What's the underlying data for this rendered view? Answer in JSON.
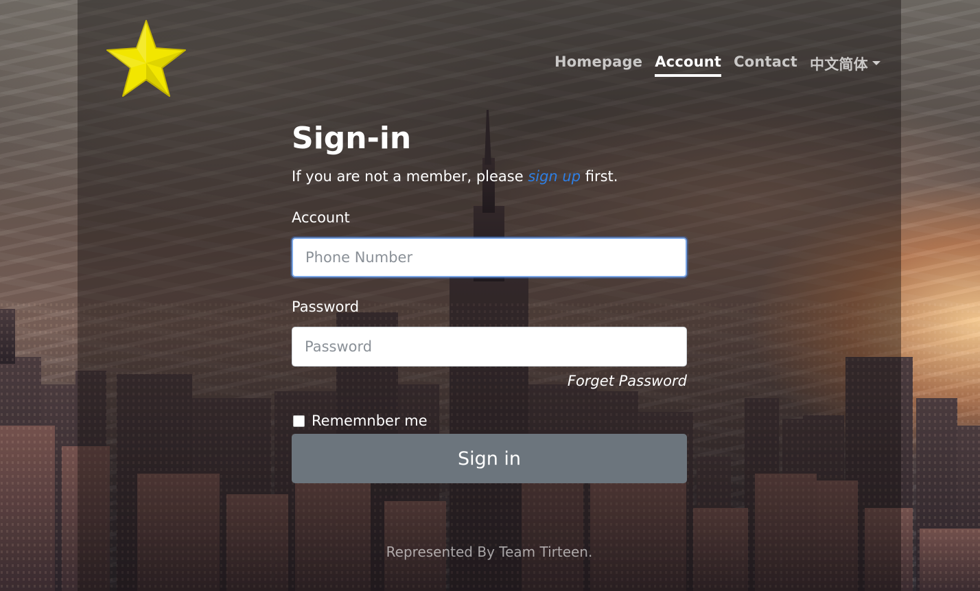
{
  "nav": {
    "items": [
      {
        "label": "Homepage",
        "active": false
      },
      {
        "label": "Account",
        "active": true
      },
      {
        "label": "Contact",
        "active": false
      }
    ],
    "language": {
      "label": "中文简体"
    }
  },
  "signin": {
    "title": "Sign-in",
    "subtitle_prefix": "If you are not a member, please ",
    "subtitle_link": "sign up",
    "subtitle_suffix": " first.",
    "account_label": "Account",
    "account_placeholder": "Phone Number",
    "password_label": "Password",
    "password_placeholder": "Password",
    "forget_password": "Forget Password",
    "remember_label": "Rememnber me",
    "button_label": "Sign in"
  },
  "footer": {
    "text": "Represented By Team Tirteen."
  },
  "colors": {
    "link": "#2f7fe3",
    "button": "#6c757d",
    "logo_star": "#f2e600"
  },
  "icons": {
    "logo": "star-icon",
    "language_dropdown": "caret-down-icon"
  }
}
